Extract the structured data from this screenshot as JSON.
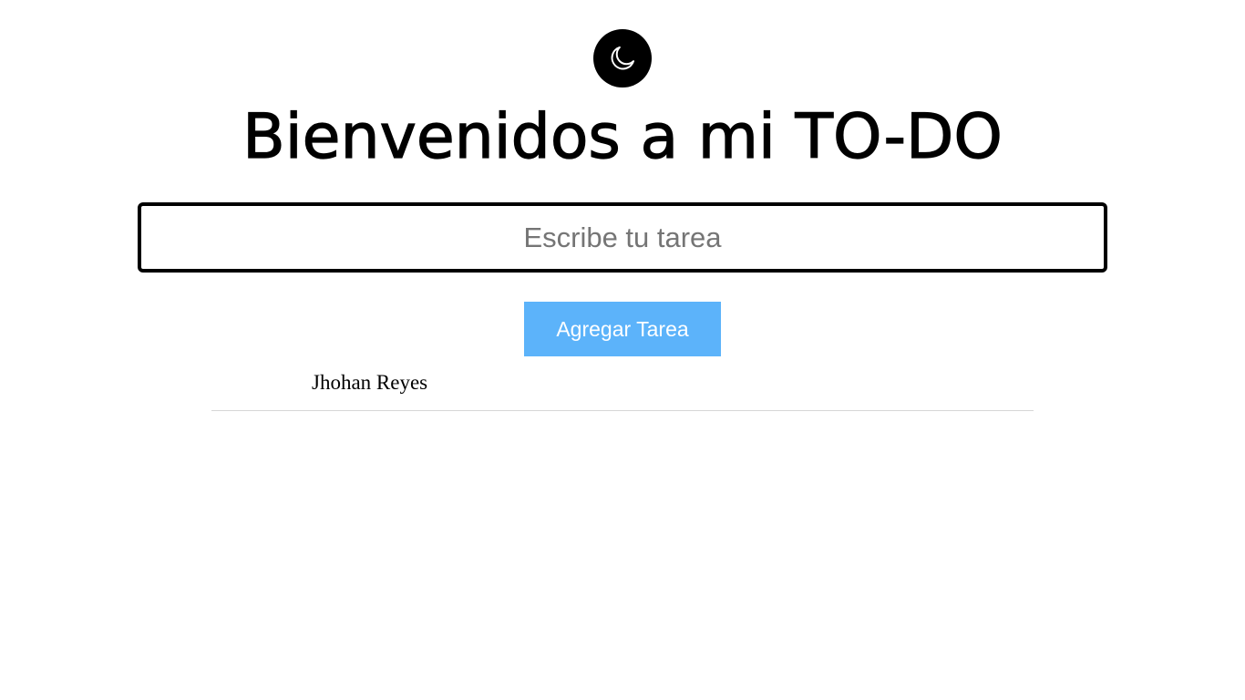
{
  "header": {
    "theme_toggle_icon": "moon-icon",
    "title": "Bienvenidos a mi TO-DO"
  },
  "form": {
    "input_value": "",
    "input_placeholder": "Escribe tu tarea",
    "add_button_label": "Agregar Tarea",
    "add_button_color": "#5cb3fa"
  },
  "tasks": [
    {
      "text": "Jhohan Reyes"
    }
  ]
}
